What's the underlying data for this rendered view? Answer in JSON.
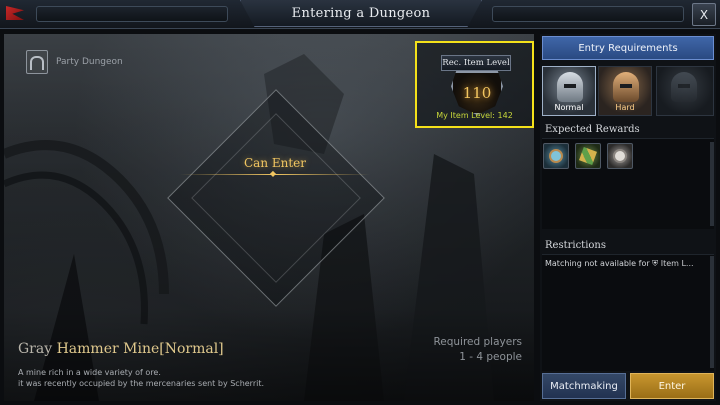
{
  "window": {
    "title": "Entering a Dungeon",
    "close_label": "X"
  },
  "scene": {
    "category": "Party Dungeon",
    "status": "Can Enter",
    "rec_item_level": {
      "label": "Rec. Item Level",
      "value": "110",
      "my_item_level": "My Item Level: 142"
    },
    "dungeon": {
      "name_part1": "Gray ",
      "name_part2": "Hammer Mine",
      "difficulty": "[Normal]",
      "description_line1": "A mine rich in a wide variety of ore.",
      "description_line2": "it was recently occupied by the mercenaries sent by Scherrit."
    },
    "required_players": {
      "label": "Required players",
      "value": "1 - 4 people"
    }
  },
  "sidebar": {
    "entry_requirements": "Entry Requirements",
    "modes": [
      {
        "label": "Normal",
        "selected": true
      },
      {
        "label": "Hard",
        "selected": false
      },
      {
        "label": "",
        "locked": true
      }
    ],
    "rewards_title": "Expected Rewards",
    "rewards": [
      "gem-reward-icon",
      "keys-reward-icon",
      "coin-reward-icon"
    ],
    "restrictions_title": "Restrictions",
    "restriction_text": "Matching not available for",
    "restriction_badge": "Item L...",
    "matchmaking_label": "Matchmaking",
    "enter_label": "Enter"
  },
  "colors": {
    "accent_gold": "#f0c561",
    "highlight_yellow": "#f4e11a",
    "header_blue": "#3f66a8",
    "enter_gold": "#c8962f"
  }
}
